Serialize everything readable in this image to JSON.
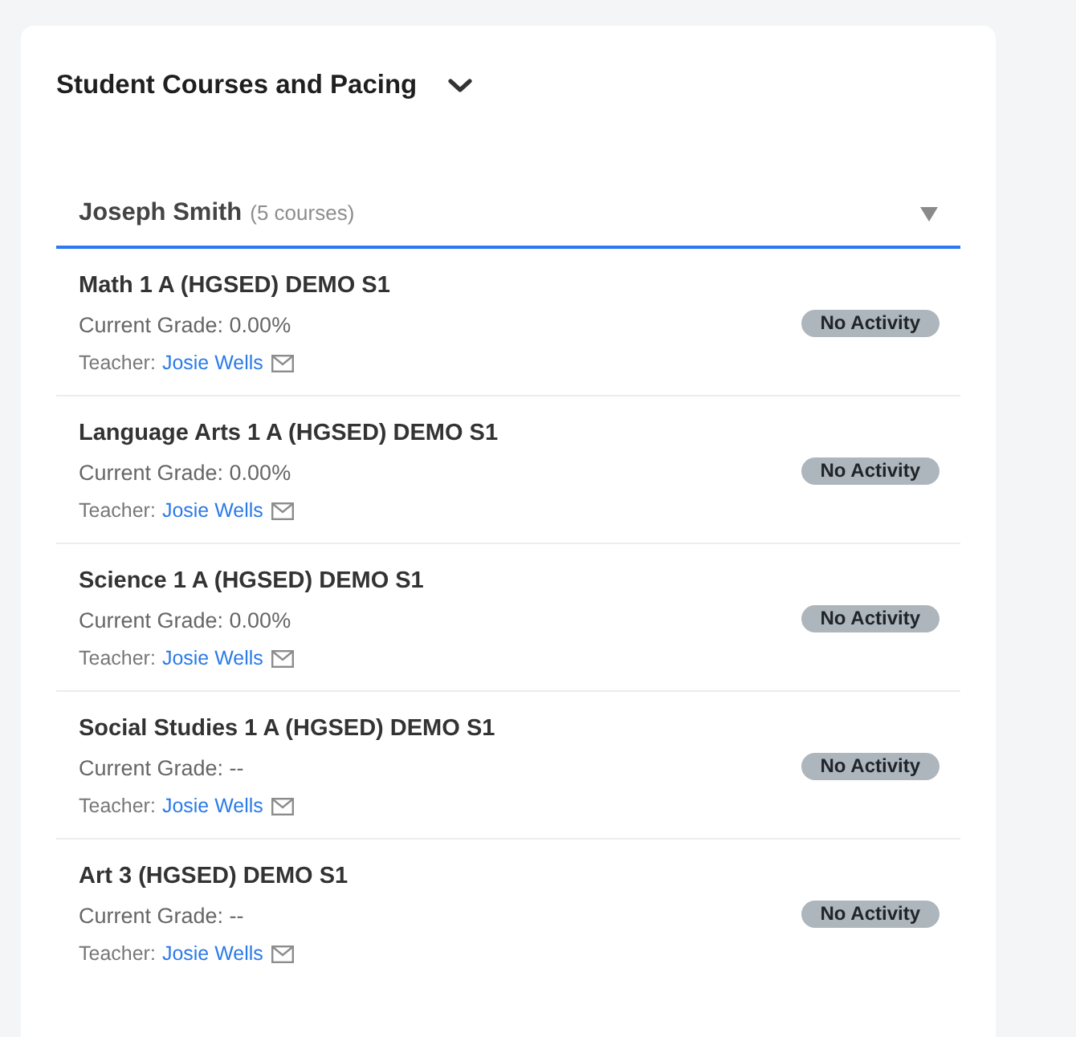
{
  "section": {
    "title": "Student Courses and Pacing"
  },
  "student_select": {
    "name": "Joseph Smith",
    "course_count": "(5 courses)"
  },
  "courses": [
    {
      "name": "Math 1 A (HGSED) DEMO S1",
      "grade": "Current Grade: 0.00%",
      "teacher_label": "Teacher:",
      "teacher": "Josie Wells",
      "status": "No Activity"
    },
    {
      "name": "Language Arts 1 A (HGSED) DEMO S1",
      "grade": "Current Grade: 0.00%",
      "teacher_label": "Teacher:",
      "teacher": "Josie Wells",
      "status": "No Activity"
    },
    {
      "name": "Science 1 A (HGSED) DEMO S1",
      "grade": "Current Grade: 0.00%",
      "teacher_label": "Teacher:",
      "teacher": "Josie Wells",
      "status": "No Activity"
    },
    {
      "name": "Social Studies 1 A (HGSED) DEMO S1",
      "grade": "Current Grade: --",
      "teacher_label": "Teacher:",
      "teacher": "Josie Wells",
      "status": "No Activity"
    },
    {
      "name": "Art 3 (HGSED) DEMO S1",
      "grade": "Current Grade: --",
      "teacher_label": "Teacher:",
      "teacher": "Josie Wells",
      "status": "No Activity"
    }
  ]
}
